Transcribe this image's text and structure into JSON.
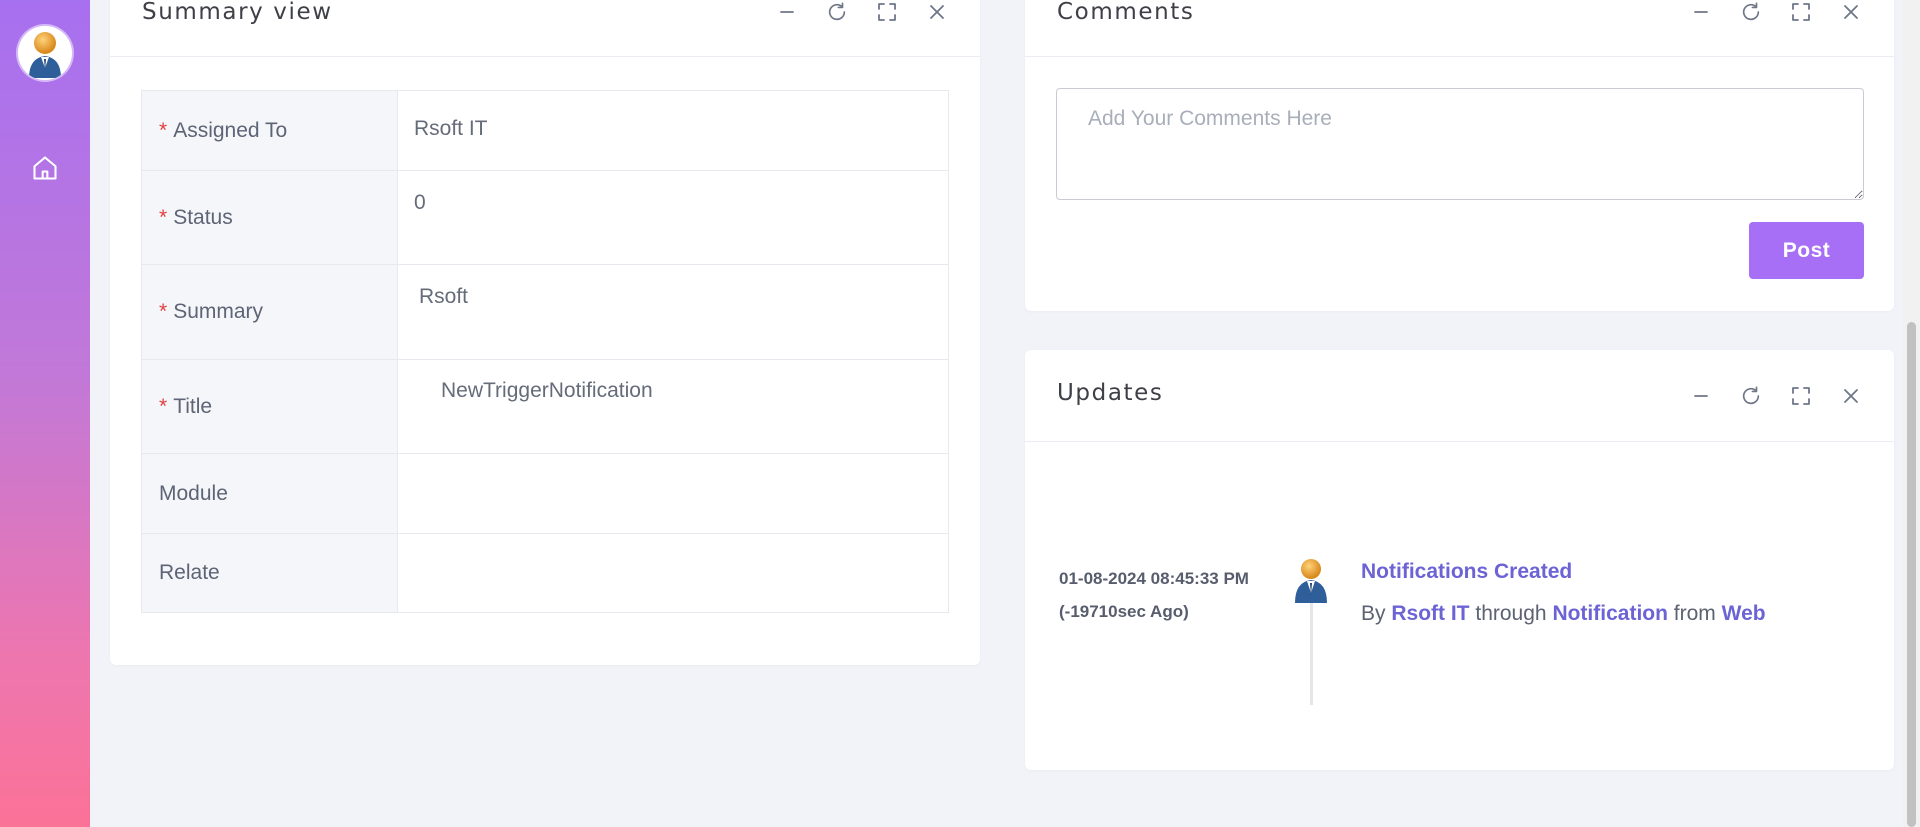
{
  "summary": {
    "title": "Summary view",
    "fields": [
      {
        "label": "Assigned To",
        "required": true,
        "value": "Rsoft IT"
      },
      {
        "label": "Status",
        "required": true,
        "value": "0"
      },
      {
        "label": "Summary",
        "required": true,
        "value": "Rsoft"
      },
      {
        "label": "Title",
        "required": true,
        "value": "NewTriggerNotification"
      },
      {
        "label": "Module",
        "required": false,
        "value": ""
      },
      {
        "label": "Relate",
        "required": false,
        "value": ""
      }
    ],
    "required_mark": "*"
  },
  "comments": {
    "title": "Comments",
    "placeholder": "Add Your Comments Here",
    "post_label": "Post"
  },
  "updates": {
    "title": "Updates",
    "items": [
      {
        "date": "01-08-2024 08:45:33 PM",
        "ago": "(-19710sec Ago)",
        "heading": "Notifications Created",
        "by_prefix": "By",
        "user": "Rsoft IT",
        "through_word": "through",
        "channel": "Notification",
        "from_word": "from",
        "source": "Web"
      }
    ]
  },
  "icons": {
    "avatar": "user-avatar-icon",
    "home": "home-icon",
    "minimize": "minimize-icon",
    "refresh": "refresh-icon",
    "fullscreen": "fullscreen-icon",
    "close": "close-icon"
  },
  "colors": {
    "accent": "#a76ff5",
    "link": "#6c63d4",
    "required": "#e0403d",
    "sidebar_top": "#a770f0",
    "sidebar_bottom": "#fb7297"
  }
}
